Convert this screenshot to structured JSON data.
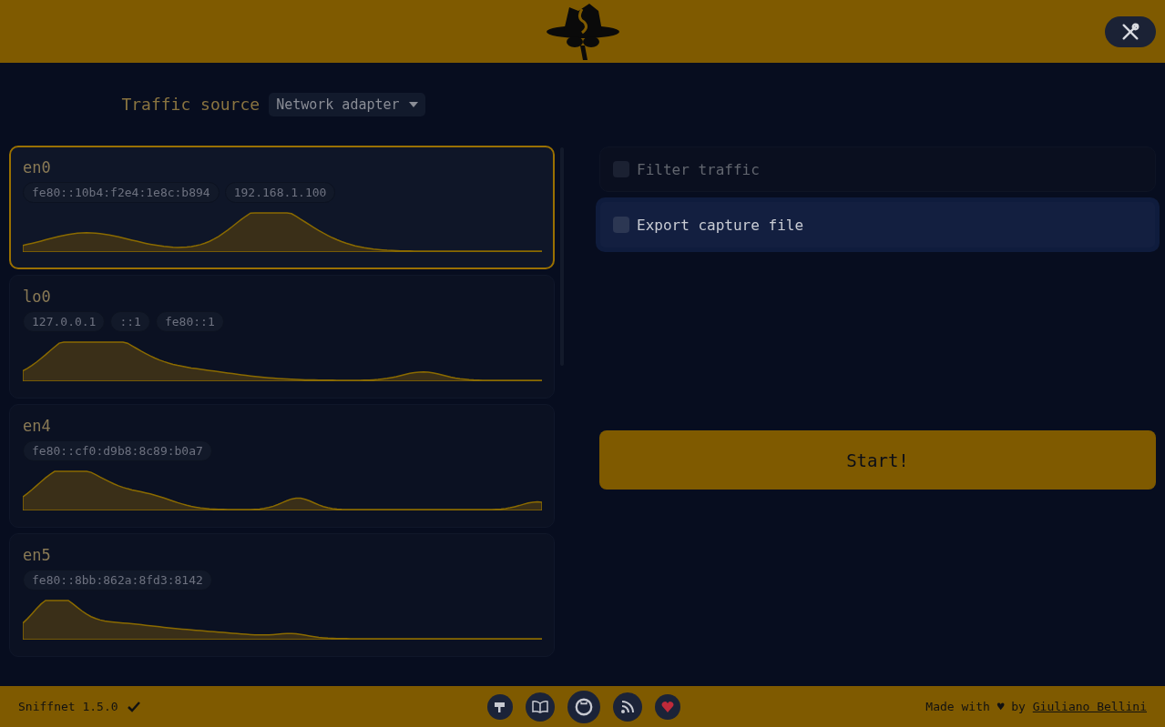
{
  "traffic_source": {
    "label": "Traffic source",
    "value": "Network adapter"
  },
  "adapters": [
    {
      "name": "en0",
      "selected": true,
      "addresses": [
        "fe80::10b4:f2e4:1e8c:b894",
        "192.168.1.100"
      ]
    },
    {
      "name": "lo0",
      "selected": false,
      "addresses": [
        "127.0.0.1",
        "::1",
        "fe80::1"
      ]
    },
    {
      "name": "en4",
      "selected": false,
      "addresses": [
        "fe80::cf0:d9b8:8c89:b0a7"
      ]
    },
    {
      "name": "en5",
      "selected": false,
      "addresses": [
        "fe80::8bb:862a:8fd3:8142"
      ]
    }
  ],
  "options": [
    {
      "label": "Filter traffic",
      "checked": false,
      "selected": false
    },
    {
      "label": "Export capture file",
      "checked": false,
      "selected": true
    }
  ],
  "start_button": "Start!",
  "footer": {
    "version": "Sniffnet 1.5.0",
    "made_with": "Made with ♥ by",
    "author": "Giuliano Bellini"
  }
}
